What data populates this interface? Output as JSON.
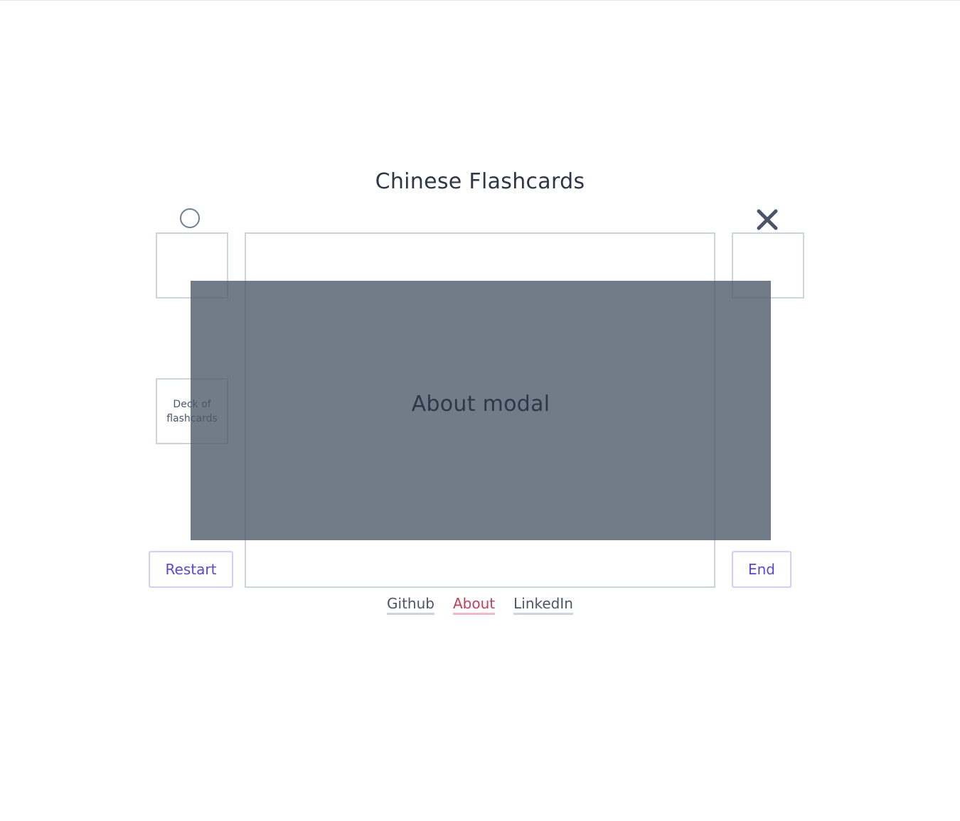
{
  "header": {
    "title": "Chinese Flashcards"
  },
  "piles": {
    "correct_icon": "circle-icon",
    "wrong_icon": "x-icon",
    "deck_label": "Deck of flashcards"
  },
  "controls": {
    "restart_label": "Restart",
    "end_label": "End"
  },
  "footer": {
    "links": [
      {
        "label": "Github",
        "active": false
      },
      {
        "label": "About",
        "active": true
      },
      {
        "label": "LinkedIn",
        "active": false
      }
    ]
  },
  "modal": {
    "title": "About modal"
  },
  "colors": {
    "text": "#2d3748",
    "border": "#cbd5e0",
    "button_text": "#5a45e0",
    "button_border": "#d6ccf7",
    "active_link": "#c53d5a",
    "modal_overlay": "#4a5a68"
  }
}
